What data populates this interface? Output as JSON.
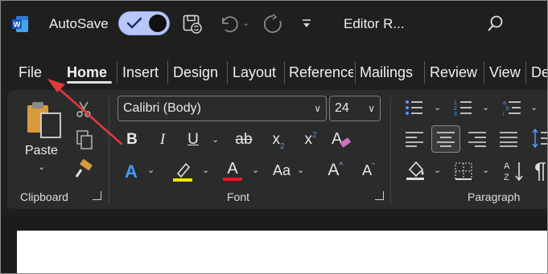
{
  "title_bar": {
    "autosave_label": "AutoSave",
    "autosave_on": true,
    "document_title": "Editor R...",
    "icons": [
      "word-logo",
      "save-icon",
      "undo-icon",
      "redo-icon",
      "customize-qat-icon",
      "search-icon"
    ]
  },
  "tabs": [
    "File",
    "Home",
    "Insert",
    "Design",
    "Layout",
    "Reference",
    "Mailings",
    "Review",
    "View",
    "De"
  ],
  "active_tab": "Home",
  "clipboard": {
    "paste_label": "Paste",
    "group_label": "Clipboard"
  },
  "font": {
    "family": "Calibri (Body)",
    "size": "24",
    "bold": "B",
    "italic": "I",
    "underline": "U",
    "strikethrough": "ab",
    "subscript_base": "x",
    "subscript_mark": "2",
    "superscript_base": "x",
    "superscript_mark": "2",
    "text_effects": "A",
    "font_color": "A",
    "change_case": "Aa",
    "grow_font": "A",
    "shrink_font": "A",
    "group_label": "Font"
  },
  "paragraph": {
    "group_label": "Paragraph"
  },
  "colors": {
    "highlight": "#f2e600",
    "font_color": "#e02020",
    "text_effects": "#4a9af5",
    "arrow": "#e03a3a"
  }
}
